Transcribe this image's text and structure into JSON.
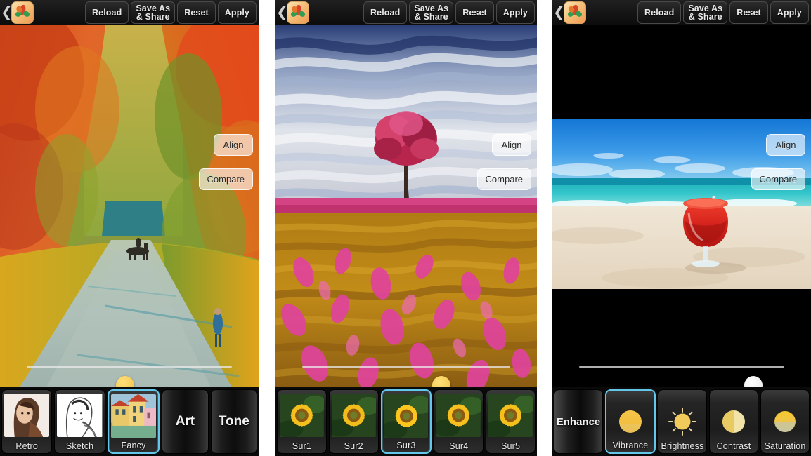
{
  "app": {
    "logo_icon": "leaf-palette-icon",
    "back_icon": "back-chevron-icon"
  },
  "toolbar": {
    "reload_label": "Reload",
    "save_label_line1": "Save As",
    "save_label_line2": "& Share",
    "reset_label": "Reset",
    "apply_label": "Apply"
  },
  "overlay": {
    "align_label": "Align",
    "compare_label": "Compare"
  },
  "colors": {
    "selected_border": "#63c7ec",
    "knob_gold": "#f6cf5c",
    "knob_white": "#ffffff",
    "toolbar_bg": "#141414",
    "filmstrip_bg": "#0a0a0a"
  },
  "panels": [
    {
      "id": "panel-art",
      "photo_name": "autumn-tree-lined-path-painting",
      "photo_alt": "Autumn avenue with orange and green trees, horse rider and walking figure on a paved path",
      "slider": {
        "value_percent": 48,
        "knob_color": "gold"
      },
      "filmstrip": [
        {
          "name": "retro",
          "label": "Retro",
          "type": "thumb",
          "thumb": "portrait-retro-thumb",
          "selected": false
        },
        {
          "name": "sketch",
          "label": "Sketch",
          "type": "thumb",
          "thumb": "portrait-sketch-thumb",
          "selected": false
        },
        {
          "name": "fancy",
          "label": "Fancy",
          "type": "thumb",
          "thumb": "village-houses-thumb",
          "selected": true
        },
        {
          "name": "art",
          "label": "Art",
          "type": "text",
          "selected": false
        },
        {
          "name": "tone",
          "label": "Tone",
          "type": "text",
          "selected": false
        }
      ]
    },
    {
      "id": "panel-surreal",
      "photo_name": "red-tree-field-painting",
      "photo_alt": "Painterly landscape: blue and white swirling sky, red tree, pink horizon band and golden field with magenta flowers",
      "slider": {
        "value_percent": 67,
        "knob_color": "gold"
      },
      "filmstrip": [
        {
          "name": "sur1",
          "label": "Sur1",
          "type": "thumb",
          "thumb": "sunflower-thumb",
          "selected": false
        },
        {
          "name": "sur2",
          "label": "Sur2",
          "type": "thumb",
          "thumb": "sunflower-thumb",
          "selected": false
        },
        {
          "name": "sur3",
          "label": "Sur3",
          "type": "thumb",
          "thumb": "sunflower-thumb",
          "selected": true
        },
        {
          "name": "sur4",
          "label": "Sur4",
          "type": "thumb",
          "thumb": "sunflower-thumb",
          "selected": false
        },
        {
          "name": "sur5",
          "label": "Sur5",
          "type": "thumb",
          "thumb": "sunflower-thumb",
          "selected": false
        }
      ]
    },
    {
      "id": "panel-enhance",
      "photo_name": "beach-cocktail-photo",
      "photo_alt": "Red frozen cocktail in a glass on white sand with turquoise sea and blue sky, letterboxed with black bars",
      "slider": {
        "value_percent": 85,
        "knob_color": "white"
      },
      "filmstrip": [
        {
          "name": "enhance",
          "label": "Enhance",
          "type": "text",
          "selected": false
        },
        {
          "name": "vibrance",
          "label": "Vibrance",
          "type": "icon",
          "icon": "vibrance-circle-icon",
          "selected": true
        },
        {
          "name": "brightness",
          "label": "Brightness",
          "type": "icon",
          "icon": "brightness-sun-icon",
          "selected": false
        },
        {
          "name": "contrast",
          "label": "Contrast",
          "type": "icon",
          "icon": "contrast-half-circle-icon",
          "selected": false
        },
        {
          "name": "saturation",
          "label": "Saturation",
          "type": "icon",
          "icon": "saturation-gradient-circle-icon",
          "selected": false
        }
      ]
    }
  ]
}
